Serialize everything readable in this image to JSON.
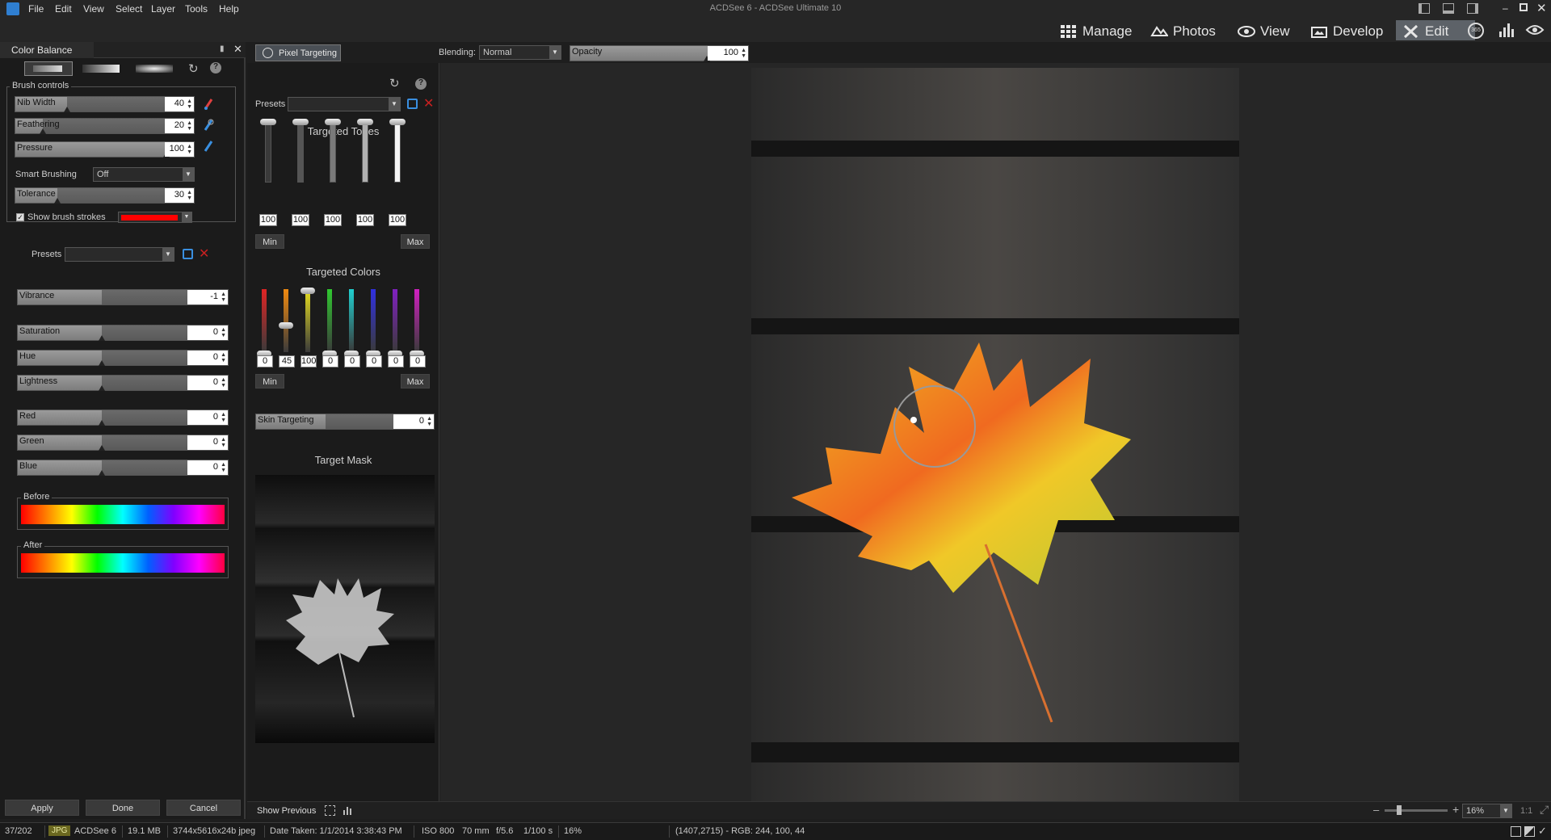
{
  "app": {
    "title": "ACDSee 6 - ACDSee Ultimate 10",
    "menu": [
      "File",
      "Edit",
      "View",
      "Select",
      "Layer",
      "Tools",
      "Help"
    ],
    "window_controls": [
      "minimize-icon",
      "maximize-icon",
      "close-icon"
    ]
  },
  "modes": {
    "manage": "Manage",
    "photos": "Photos",
    "view": "View",
    "develop": "Develop",
    "edit": "Edit",
    "badge_365": "365"
  },
  "left_panel": {
    "title": "Color Balance",
    "brush_controls": {
      "label": "Brush controls",
      "nib_width": {
        "label": "Nib Width",
        "value": "40"
      },
      "feathering": {
        "label": "Feathering",
        "value": "20"
      },
      "pressure": {
        "label": "Pressure",
        "value": "100"
      },
      "smart_brushing": {
        "label": "Smart Brushing",
        "value": "Off"
      },
      "tolerance": {
        "label": "Tolerance",
        "value": "30"
      },
      "show_strokes": {
        "label": "Show brush strokes",
        "checked": true,
        "color": "#ff0000"
      }
    },
    "presets_label": "Presets",
    "adjust": {
      "vibrance": {
        "label": "Vibrance",
        "value": "-1"
      },
      "saturation": {
        "label": "Saturation",
        "value": "0"
      },
      "hue": {
        "label": "Hue",
        "value": "0"
      },
      "lightness": {
        "label": "Lightness",
        "value": "0"
      },
      "red": {
        "label": "Red",
        "value": "0"
      },
      "green": {
        "label": "Green",
        "value": "0"
      },
      "blue": {
        "label": "Blue",
        "value": "0"
      }
    },
    "before_label": "Before",
    "after_label": "After",
    "buttons": {
      "apply": "Apply",
      "done": "Done",
      "cancel": "Cancel"
    }
  },
  "pixel_targeting": {
    "button_label": "Pixel Targeting",
    "blending_label": "Blending:",
    "blending_value": "Normal",
    "opacity_label": "Opacity",
    "opacity_value": "100",
    "presets_label": "Presets",
    "tones_title": "Targeted Tones",
    "tones": [
      {
        "value": "100",
        "shade": "#3a3a3a"
      },
      {
        "value": "100",
        "shade": "#555555"
      },
      {
        "value": "100",
        "shade": "#7a7a7a"
      },
      {
        "value": "100",
        "shade": "#b0b0b0"
      },
      {
        "value": "100",
        "shade": "#f4f4f4"
      }
    ],
    "min_label": "Min",
    "max_label": "Max",
    "colors_title": "Targeted Colors",
    "colors": [
      {
        "value": "0",
        "color": "#e02424"
      },
      {
        "value": "45",
        "color": "#f08a10"
      },
      {
        "value": "100",
        "color": "#e8e020"
      },
      {
        "value": "0",
        "color": "#30c830"
      },
      {
        "value": "0",
        "color": "#20d0d0"
      },
      {
        "value": "0",
        "color": "#3030e0"
      },
      {
        "value": "0",
        "color": "#8020c0"
      },
      {
        "value": "0",
        "color": "#d020c0"
      }
    ],
    "skin_label": "Skin Targeting",
    "skin_value": "0",
    "mask_title": "Target Mask"
  },
  "bottom": {
    "show_previous": "Show Previous",
    "zoom": "16%",
    "ratio": "1:1"
  },
  "status": {
    "index": "37/202",
    "format": "JPG",
    "filename": "ACDSee 6",
    "size": "19.1 MB",
    "dimensions": "3744x5616x24b jpeg",
    "date": "Date Taken: 1/1/2014 3:38:43 PM",
    "iso": "ISO 800",
    "focal": "70 mm",
    "aperture": "f/5.6",
    "shutter": "1/100 s",
    "zoom": "16%",
    "pixel_info": "(1407,2715) - RGB: 244, 100, 44"
  }
}
